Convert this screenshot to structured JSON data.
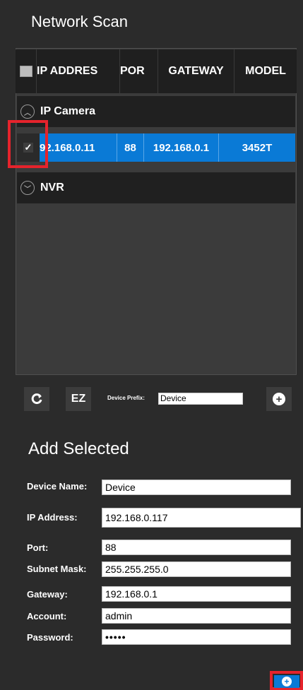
{
  "title": "Network Scan",
  "table": {
    "headers": {
      "ip": "IP ADDRES",
      "port": "POR",
      "gateway": "GATEWAY",
      "model": "MODEL"
    },
    "groups": [
      {
        "label": "IP Camera"
      },
      {
        "label": "NVR"
      }
    ],
    "selected_row": {
      "check": "✓",
      "ip": "92.168.0.11",
      "port": "88",
      "gateway": "192.168.0.1",
      "model": "3452T"
    }
  },
  "toolbar": {
    "refresh_icon": "refresh-icon",
    "ez_label": "EZ",
    "prefix_label": "Device Prefix:",
    "prefix_value": "Device"
  },
  "add_selected": {
    "title": "Add Selected",
    "fields": {
      "device_name": {
        "label": "Device Name:",
        "value": "Device"
      },
      "ip_address": {
        "label": "IP Address:",
        "value": "192.168.0.117"
      },
      "port": {
        "label": "Port:",
        "value": "88"
      },
      "subnet_mask": {
        "label": "Subnet Mask:",
        "value": "255.255.255.0"
      },
      "gateway": {
        "label": "Gateway:",
        "value": "192.168.0.1"
      },
      "account": {
        "label": "Account:",
        "value": "admin"
      },
      "password": {
        "label": "Password:",
        "value": "•••••"
      }
    }
  },
  "colors": {
    "accent": "#0a7ad6",
    "highlight": "#e5232c",
    "background": "#2b2b2b"
  }
}
